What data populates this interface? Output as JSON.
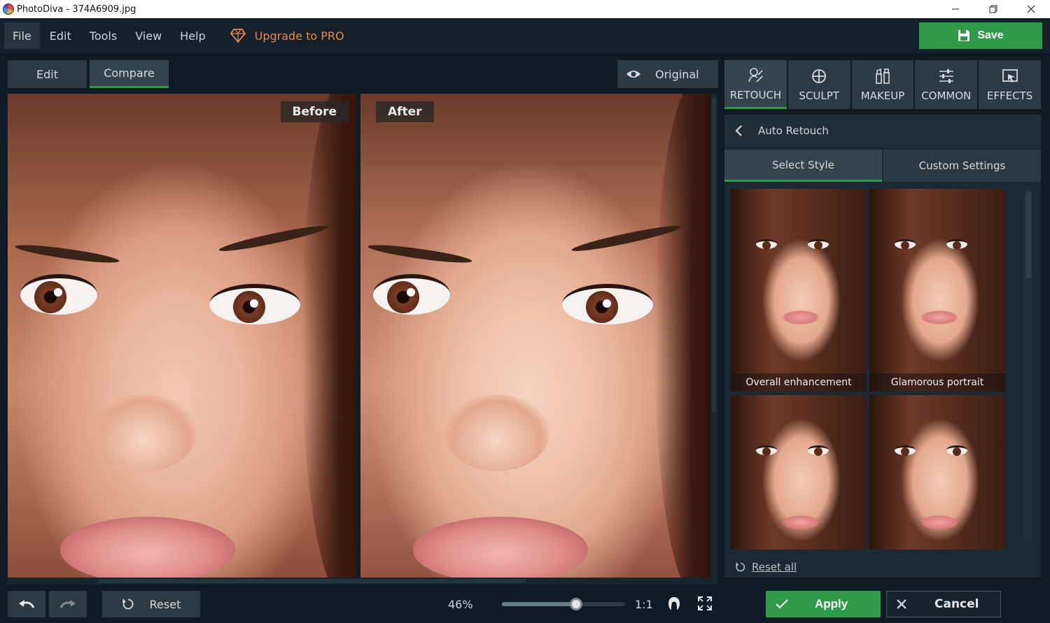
{
  "window": {
    "title": "PhotoDiva - 374A6909.jpg",
    "controls": [
      "minimize",
      "restore",
      "close"
    ]
  },
  "menu": {
    "items": [
      "File",
      "Edit",
      "Tools",
      "View",
      "Help"
    ],
    "upgrade_label": "Upgrade to PRO",
    "save_label": "Save"
  },
  "view_tabs": {
    "edit": "Edit",
    "compare": "Compare",
    "original": "Original"
  },
  "compare": {
    "before_label": "Before",
    "after_label": "After"
  },
  "tools": {
    "tabs": [
      "RETOUCH",
      "SCULPT",
      "MAKEUP",
      "COMMON",
      "EFFECTS"
    ],
    "active": "RETOUCH"
  },
  "panel": {
    "header": "Auto Retouch",
    "subtabs": [
      "Select Style",
      "Custom Settings"
    ],
    "active_subtab": "Select Style",
    "styles": [
      {
        "caption": "Overall enhancement"
      },
      {
        "caption": "Glamorous portrait"
      },
      {
        "caption": ""
      },
      {
        "caption": ""
      }
    ],
    "reset_all": "Reset all"
  },
  "bottom": {
    "reset_label": "Reset",
    "zoom_percent": "46%",
    "zoom_level": 0.6,
    "one_to_one": "1:1",
    "apply_label": "Apply",
    "cancel_label": "Cancel"
  },
  "colors": {
    "accent_green": "#2f9a49",
    "upgrade_orange": "#e98a4c",
    "background": "#0f1b24"
  }
}
